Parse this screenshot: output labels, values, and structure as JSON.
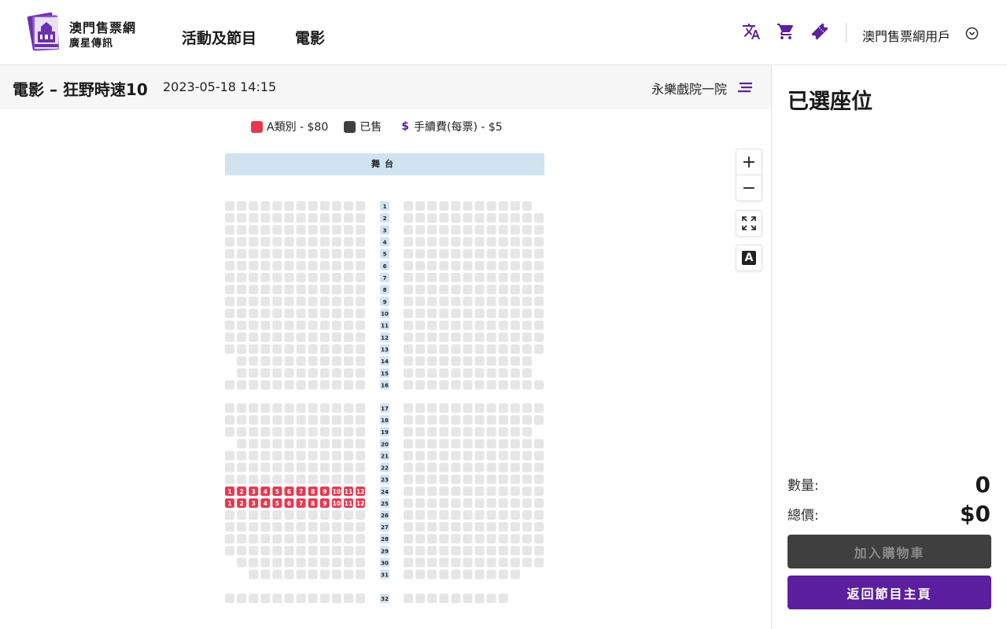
{
  "brand": {
    "name": "澳門售票網",
    "sub": "廣星傳訊"
  },
  "nav": [
    {
      "label": "活動及節目"
    },
    {
      "label": "電影"
    }
  ],
  "header_icons": [
    "translate-icon",
    "cart-icon",
    "ticket-icon"
  ],
  "user": {
    "label": "澳門售票網用戶"
  },
  "event": {
    "title": "電影 – 狂野時速10",
    "datetime": "2023-05-18 14:15",
    "venue": "永樂戲院一院"
  },
  "legend": {
    "category": "A類別 - $80",
    "sold": "已售",
    "fee_symbol": "$",
    "fee": "手續費(每票) - $5"
  },
  "colors": {
    "accent": "#5b1fa0",
    "category_a": "#e8384f",
    "sold": "#3f3f3f",
    "available": "#e6e6e6",
    "stage": "#d1e3f1"
  },
  "stage": {
    "label": "舞台"
  },
  "rows": [
    "1",
    "2",
    "3",
    "4",
    "5",
    "6",
    "7",
    "8",
    "9",
    "10",
    "11",
    "12",
    "13",
    "14",
    "15",
    "16",
    "17",
    "18",
    "19",
    "20",
    "21",
    "22",
    "23",
    "24",
    "25",
    "26",
    "27",
    "28",
    "29",
    "30",
    "31",
    "32"
  ],
  "category_a_rows": [
    "24",
    "25"
  ],
  "category_a_seats": [
    "1",
    "2",
    "3",
    "4",
    "5",
    "6",
    "7",
    "8",
    "9",
    "10",
    "11",
    "12"
  ],
  "selection": {
    "title": "已選座位",
    "qty_label": "數量:",
    "qty": "0",
    "total_label": "總價:",
    "total": "$0"
  },
  "buttons": {
    "add_to_cart": "加入購物車",
    "back_home": "返回節目主頁"
  },
  "zoom": {
    "in": "+",
    "out": "−",
    "label_toggle": "A"
  }
}
